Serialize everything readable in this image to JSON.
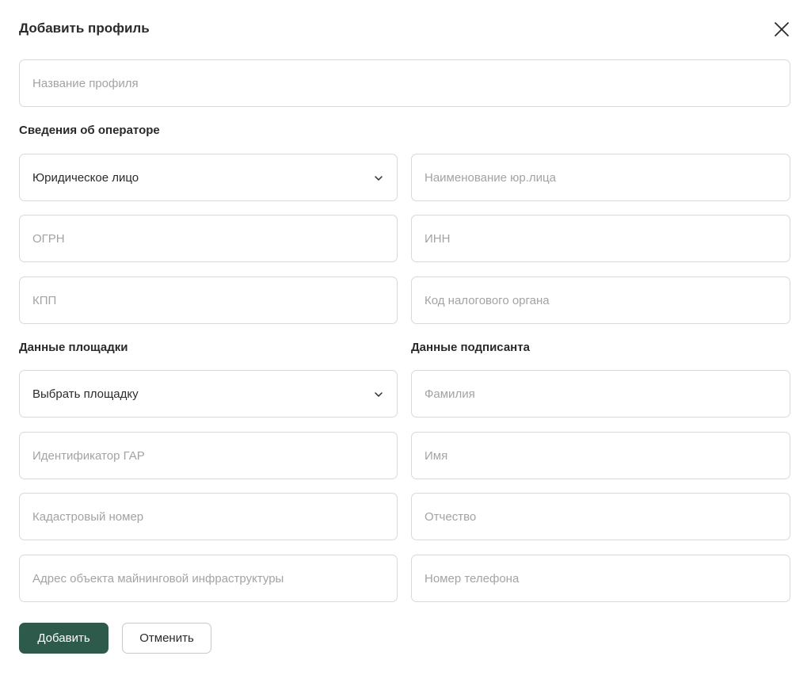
{
  "dialog": {
    "title": "Добавить профиль"
  },
  "profile_name": {
    "placeholder": "Название профиля"
  },
  "operator": {
    "heading": "Сведения об операторе",
    "entity_type": "Юридическое лицо",
    "legal_name": "Наименование юр.лица",
    "ogrn": "ОГРН",
    "inn": "ИНН",
    "kpp": "КПП",
    "tax_code": "Код налогового органа"
  },
  "site": {
    "heading": "Данные площадки",
    "select": "Выбрать площадку",
    "gar_id": "Идентификатор ГАР",
    "cadastral": "Кадастровый номер",
    "address": "Адрес объекта майнинговой инфраструктуры"
  },
  "signer": {
    "heading": "Данные подписанта",
    "surname": "Фамилия",
    "name": "Имя",
    "patronymic": "Отчество",
    "phone": "Номер телефона"
  },
  "actions": {
    "add": "Добавить",
    "cancel": "Отменить"
  },
  "colors": {
    "primary": "#2d5a4a",
    "border": "#d9d9d9",
    "placeholder": "#a3a3a3",
    "text": "#2b2b2b"
  },
  "icons": {
    "close": "close-icon",
    "dropdown": "chevron-down-icon"
  }
}
